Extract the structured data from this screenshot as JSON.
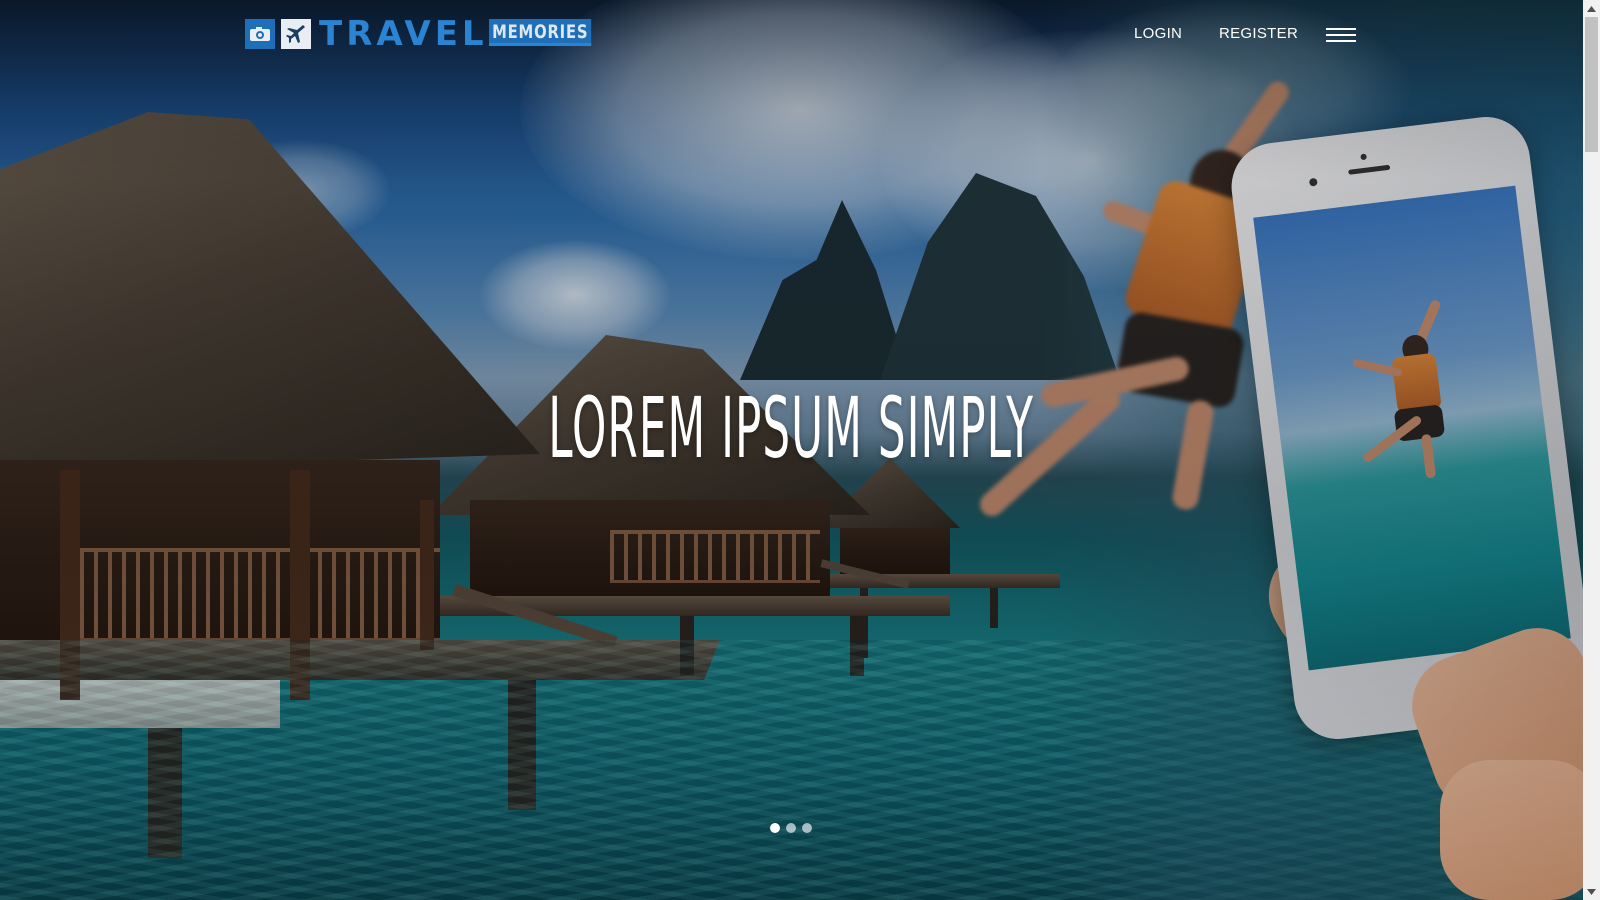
{
  "brand": {
    "word_main": "TRAVEL",
    "word_sub": "MEMORIES",
    "badge_icons": [
      "camera-icon",
      "airplane-icon"
    ]
  },
  "nav": {
    "login_label": "LOGIN",
    "register_label": "REGISTER",
    "menu_icon": "hamburger-menu-icon"
  },
  "hero": {
    "headline": "LOREM IPSUM SIMPLY",
    "slides_total": 3,
    "active_slide": 1
  },
  "colors": {
    "brand_blue": "#2b83d1",
    "brand_dark_blue": "#1f6fb8",
    "nav_text": "#ffffff"
  }
}
